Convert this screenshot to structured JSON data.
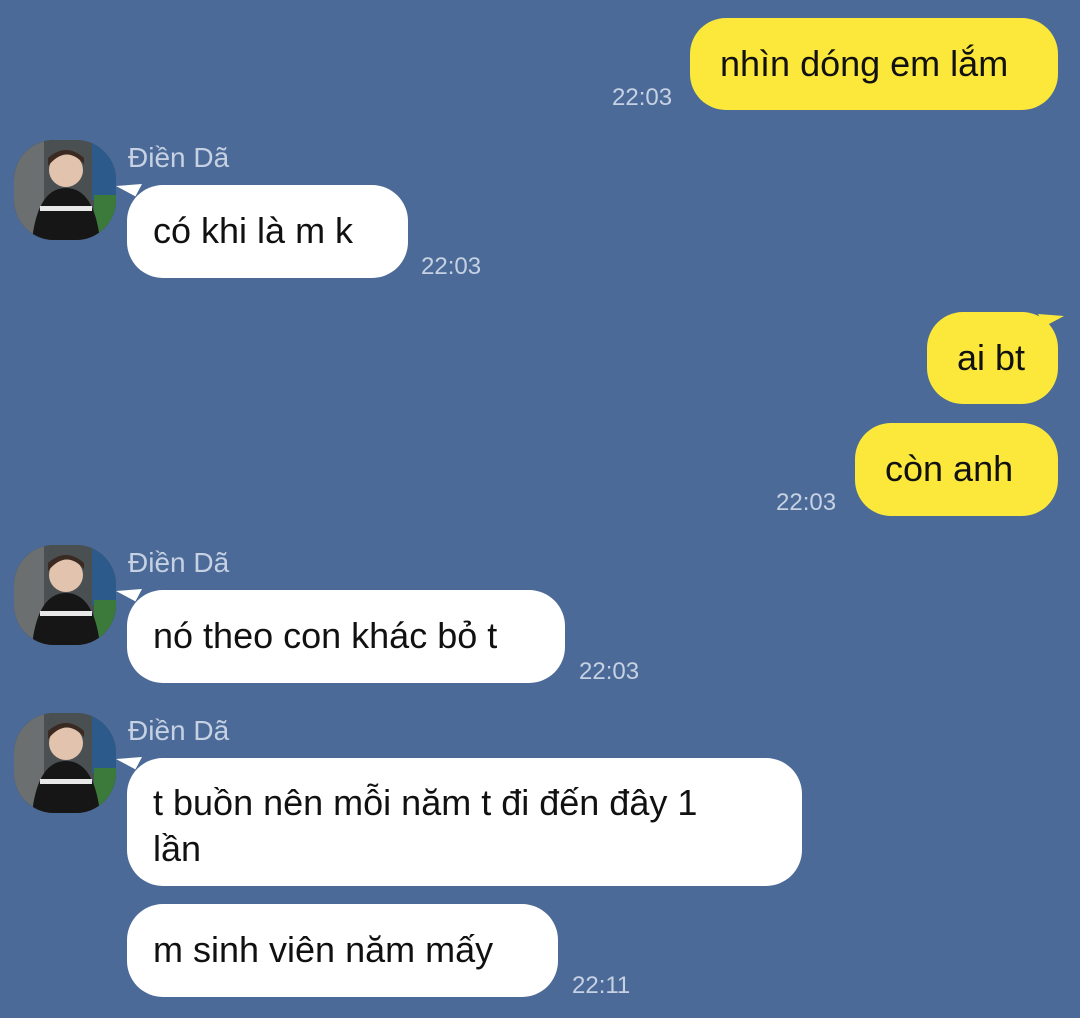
{
  "chat": {
    "contact_name": "Điền Dã",
    "messages": [
      {
        "side": "out",
        "text": "nhìn dóng em lắm",
        "time": "22:03"
      },
      {
        "side": "in",
        "sender": "Điền Dã",
        "text": "có khi là m k",
        "time": "22:03"
      },
      {
        "side": "out",
        "text": "ai bt"
      },
      {
        "side": "out",
        "text": "còn anh",
        "time": "22:03"
      },
      {
        "side": "in",
        "sender": "Điền Dã",
        "text": "nó theo con khác bỏ t",
        "time": "22:03"
      },
      {
        "side": "in",
        "sender": "Điền Dã",
        "text_line1": "t buồn nên mỗi năm t đi đến đây 1",
        "text_line2": "lần"
      },
      {
        "side": "in",
        "text": "m sinh viên năm mấy",
        "time": "22:11"
      }
    ]
  },
  "colors": {
    "background": "#4b6a97",
    "outgoing_bubble": "#fbe83a",
    "incoming_bubble": "#ffffff",
    "meta_text": "#c6d1e3"
  }
}
